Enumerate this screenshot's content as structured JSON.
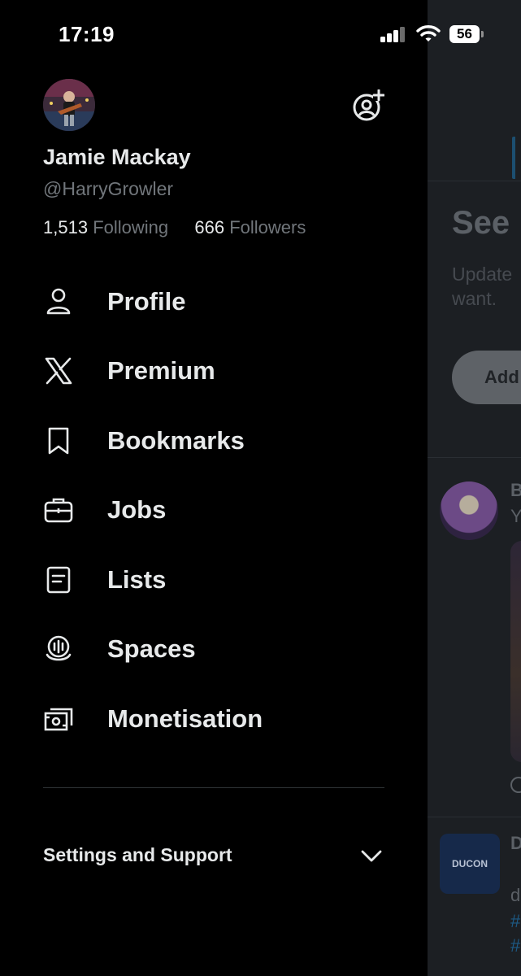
{
  "status_bar": {
    "time": "17:19",
    "battery": "56"
  },
  "profile": {
    "display_name": "Jamie Mackay",
    "handle": "@HarryGrowler",
    "following_count": "1,513",
    "following_label": "Following",
    "followers_count": "666",
    "followers_label": "Followers"
  },
  "menu": {
    "items": [
      {
        "label": "Profile",
        "icon": "person-icon"
      },
      {
        "label": "Premium",
        "icon": "x-logo-icon"
      },
      {
        "label": "Bookmarks",
        "icon": "bookmark-icon"
      },
      {
        "label": "Jobs",
        "icon": "briefcase-icon"
      },
      {
        "label": "Lists",
        "icon": "list-icon"
      },
      {
        "label": "Spaces",
        "icon": "spaces-icon"
      },
      {
        "label": "Monetisation",
        "icon": "money-icon"
      }
    ]
  },
  "settings": {
    "label": "Settings and Support",
    "icon": "chevron-down-icon"
  },
  "background": {
    "heading": "See",
    "text_line1": "Update",
    "text_line2": "want.",
    "button_label": "Add",
    "post1_name": "B",
    "post1_text": "Y",
    "post2_name": "D",
    "post2_avatar_text": "DUCON",
    "post2_text": "d",
    "post2_tag1": "#",
    "post2_tag2": "#"
  },
  "colors": {
    "background": "#000000",
    "text_primary": "#e7e9ea",
    "text_secondary": "#71767b",
    "divider": "#2f3336"
  }
}
